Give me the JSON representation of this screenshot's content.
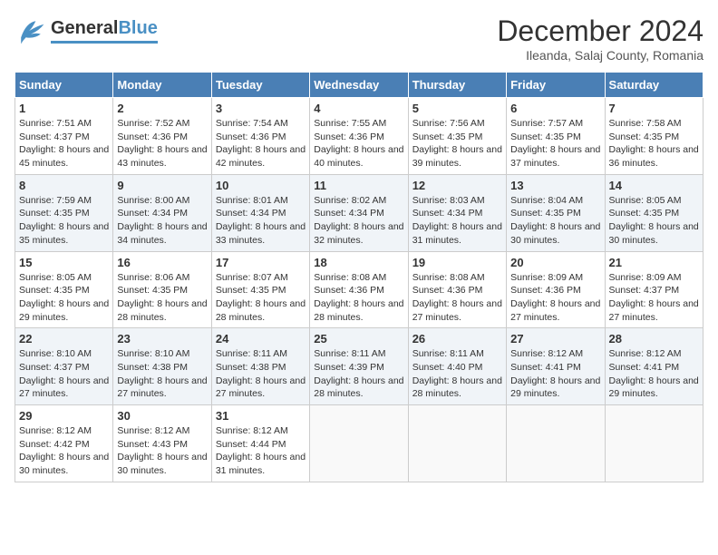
{
  "header": {
    "logo": {
      "general": "General",
      "blue": "Blue"
    },
    "month": "December 2024",
    "location": "Ileanda, Salaj County, Romania"
  },
  "weekdays": [
    "Sunday",
    "Monday",
    "Tuesday",
    "Wednesday",
    "Thursday",
    "Friday",
    "Saturday"
  ],
  "weeks": [
    [
      {
        "day": "1",
        "sunrise": "Sunrise: 7:51 AM",
        "sunset": "Sunset: 4:37 PM",
        "daylight": "Daylight: 8 hours and 45 minutes."
      },
      {
        "day": "2",
        "sunrise": "Sunrise: 7:52 AM",
        "sunset": "Sunset: 4:36 PM",
        "daylight": "Daylight: 8 hours and 43 minutes."
      },
      {
        "day": "3",
        "sunrise": "Sunrise: 7:54 AM",
        "sunset": "Sunset: 4:36 PM",
        "daylight": "Daylight: 8 hours and 42 minutes."
      },
      {
        "day": "4",
        "sunrise": "Sunrise: 7:55 AM",
        "sunset": "Sunset: 4:36 PM",
        "daylight": "Daylight: 8 hours and 40 minutes."
      },
      {
        "day": "5",
        "sunrise": "Sunrise: 7:56 AM",
        "sunset": "Sunset: 4:35 PM",
        "daylight": "Daylight: 8 hours and 39 minutes."
      },
      {
        "day": "6",
        "sunrise": "Sunrise: 7:57 AM",
        "sunset": "Sunset: 4:35 PM",
        "daylight": "Daylight: 8 hours and 37 minutes."
      },
      {
        "day": "7",
        "sunrise": "Sunrise: 7:58 AM",
        "sunset": "Sunset: 4:35 PM",
        "daylight": "Daylight: 8 hours and 36 minutes."
      }
    ],
    [
      {
        "day": "8",
        "sunrise": "Sunrise: 7:59 AM",
        "sunset": "Sunset: 4:35 PM",
        "daylight": "Daylight: 8 hours and 35 minutes."
      },
      {
        "day": "9",
        "sunrise": "Sunrise: 8:00 AM",
        "sunset": "Sunset: 4:34 PM",
        "daylight": "Daylight: 8 hours and 34 minutes."
      },
      {
        "day": "10",
        "sunrise": "Sunrise: 8:01 AM",
        "sunset": "Sunset: 4:34 PM",
        "daylight": "Daylight: 8 hours and 33 minutes."
      },
      {
        "day": "11",
        "sunrise": "Sunrise: 8:02 AM",
        "sunset": "Sunset: 4:34 PM",
        "daylight": "Daylight: 8 hours and 32 minutes."
      },
      {
        "day": "12",
        "sunrise": "Sunrise: 8:03 AM",
        "sunset": "Sunset: 4:34 PM",
        "daylight": "Daylight: 8 hours and 31 minutes."
      },
      {
        "day": "13",
        "sunrise": "Sunrise: 8:04 AM",
        "sunset": "Sunset: 4:35 PM",
        "daylight": "Daylight: 8 hours and 30 minutes."
      },
      {
        "day": "14",
        "sunrise": "Sunrise: 8:05 AM",
        "sunset": "Sunset: 4:35 PM",
        "daylight": "Daylight: 8 hours and 30 minutes."
      }
    ],
    [
      {
        "day": "15",
        "sunrise": "Sunrise: 8:05 AM",
        "sunset": "Sunset: 4:35 PM",
        "daylight": "Daylight: 8 hours and 29 minutes."
      },
      {
        "day": "16",
        "sunrise": "Sunrise: 8:06 AM",
        "sunset": "Sunset: 4:35 PM",
        "daylight": "Daylight: 8 hours and 28 minutes."
      },
      {
        "day": "17",
        "sunrise": "Sunrise: 8:07 AM",
        "sunset": "Sunset: 4:35 PM",
        "daylight": "Daylight: 8 hours and 28 minutes."
      },
      {
        "day": "18",
        "sunrise": "Sunrise: 8:08 AM",
        "sunset": "Sunset: 4:36 PM",
        "daylight": "Daylight: 8 hours and 28 minutes."
      },
      {
        "day": "19",
        "sunrise": "Sunrise: 8:08 AM",
        "sunset": "Sunset: 4:36 PM",
        "daylight": "Daylight: 8 hours and 27 minutes."
      },
      {
        "day": "20",
        "sunrise": "Sunrise: 8:09 AM",
        "sunset": "Sunset: 4:36 PM",
        "daylight": "Daylight: 8 hours and 27 minutes."
      },
      {
        "day": "21",
        "sunrise": "Sunrise: 8:09 AM",
        "sunset": "Sunset: 4:37 PM",
        "daylight": "Daylight: 8 hours and 27 minutes."
      }
    ],
    [
      {
        "day": "22",
        "sunrise": "Sunrise: 8:10 AM",
        "sunset": "Sunset: 4:37 PM",
        "daylight": "Daylight: 8 hours and 27 minutes."
      },
      {
        "day": "23",
        "sunrise": "Sunrise: 8:10 AM",
        "sunset": "Sunset: 4:38 PM",
        "daylight": "Daylight: 8 hours and 27 minutes."
      },
      {
        "day": "24",
        "sunrise": "Sunrise: 8:11 AM",
        "sunset": "Sunset: 4:38 PM",
        "daylight": "Daylight: 8 hours and 27 minutes."
      },
      {
        "day": "25",
        "sunrise": "Sunrise: 8:11 AM",
        "sunset": "Sunset: 4:39 PM",
        "daylight": "Daylight: 8 hours and 28 minutes."
      },
      {
        "day": "26",
        "sunrise": "Sunrise: 8:11 AM",
        "sunset": "Sunset: 4:40 PM",
        "daylight": "Daylight: 8 hours and 28 minutes."
      },
      {
        "day": "27",
        "sunrise": "Sunrise: 8:12 AM",
        "sunset": "Sunset: 4:41 PM",
        "daylight": "Daylight: 8 hours and 29 minutes."
      },
      {
        "day": "28",
        "sunrise": "Sunrise: 8:12 AM",
        "sunset": "Sunset: 4:41 PM",
        "daylight": "Daylight: 8 hours and 29 minutes."
      }
    ],
    [
      {
        "day": "29",
        "sunrise": "Sunrise: 8:12 AM",
        "sunset": "Sunset: 4:42 PM",
        "daylight": "Daylight: 8 hours and 30 minutes."
      },
      {
        "day": "30",
        "sunrise": "Sunrise: 8:12 AM",
        "sunset": "Sunset: 4:43 PM",
        "daylight": "Daylight: 8 hours and 30 minutes."
      },
      {
        "day": "31",
        "sunrise": "Sunrise: 8:12 AM",
        "sunset": "Sunset: 4:44 PM",
        "daylight": "Daylight: 8 hours and 31 minutes."
      },
      null,
      null,
      null,
      null
    ]
  ]
}
